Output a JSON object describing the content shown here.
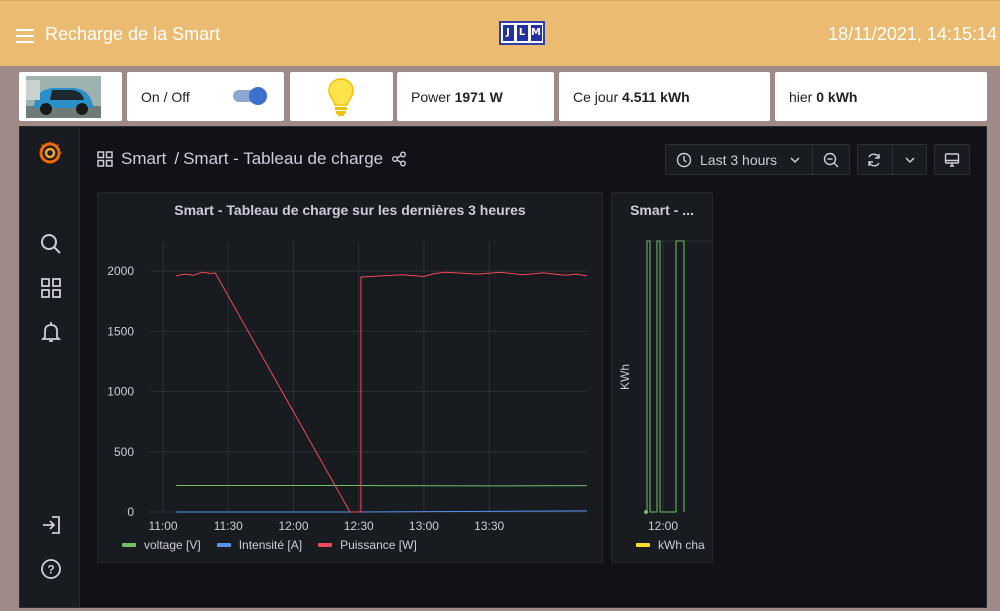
{
  "header": {
    "title": "Recharge de la Smart",
    "logo_letters": [
      "J",
      "L",
      "M"
    ],
    "datetime": "18/11/2021, 14:15:14"
  },
  "cards": {
    "toggle_label": "On / Off",
    "toggle_on": true,
    "power_label": "Power",
    "power_value": "1971 W",
    "today_label": "Ce jour",
    "today_value": "4.511 kWh",
    "yesterday_label": "hier",
    "yesterday_value": "0 kWh"
  },
  "dashboard": {
    "folder": "Smart",
    "separator": "/",
    "name": "Smart - Tableau de charge",
    "time_range": "Last 3 hours"
  },
  "colors": {
    "voltage": "#73bf69",
    "intensite": "#5794f2",
    "puissance": "#f2495c",
    "kwh": "#fade2a",
    "kwh_line": "#73bf69"
  },
  "chart_data": [
    {
      "type": "line",
      "title": "Smart - Tableau de charge sur les dernières 3 heures",
      "x_ticks": [
        "11:00",
        "11:30",
        "12:00",
        "12:30",
        "13:00",
        "13:30"
      ],
      "y_ticks": [
        "0",
        "500",
        "1000",
        "1500",
        "2000"
      ],
      "ylim": [
        0,
        2250
      ],
      "xlim": [
        "10:54",
        "14:15"
      ],
      "grid": true,
      "legend_position": "bottom-left",
      "series": [
        {
          "name": "voltage [V]",
          "color_key": "voltage",
          "points": [
            [
              "11:06",
              220
            ],
            [
              "12:30",
              220
            ],
            [
              "13:00",
              218
            ],
            [
              "13:30",
              217
            ],
            [
              "14:15",
              219
            ]
          ]
        },
        {
          "name": "Intensité [A]",
          "color_key": "intensite",
          "points": [
            [
              "11:06",
              0
            ],
            [
              "12:30",
              0
            ],
            [
              "14:15",
              9
            ]
          ]
        },
        {
          "name": "Puissance [W]",
          "color_key": "puissance",
          "points": [
            [
              "11:06",
              1960
            ],
            [
              "11:10",
              1975
            ],
            [
              "11:14",
              1965
            ],
            [
              "11:18",
              1990
            ],
            [
              "11:22",
              1980
            ],
            [
              "11:24",
              1985
            ],
            [
              "12:26",
              0
            ],
            [
              "12:31",
              0
            ],
            [
              "12:31",
              1950
            ],
            [
              "12:40",
              1960
            ],
            [
              "12:50",
              1970
            ],
            [
              "13:00",
              1955
            ],
            [
              "13:05",
              1980
            ],
            [
              "13:10",
              1990
            ],
            [
              "13:15",
              1985
            ],
            [
              "13:25",
              1975
            ],
            [
              "13:35",
              1990
            ],
            [
              "13:45",
              1970
            ],
            [
              "13:55",
              1985
            ],
            [
              "14:05",
              1965
            ],
            [
              "14:10",
              1975
            ],
            [
              "14:15",
              1960
            ]
          ]
        }
      ]
    },
    {
      "type": "line",
      "title": "Smart - ...",
      "ylabel": "KWh",
      "x_ticks": [
        "12:00"
      ],
      "series": [
        {
          "name": "kWh cha",
          "color_key": "kwh"
        }
      ]
    }
  ]
}
